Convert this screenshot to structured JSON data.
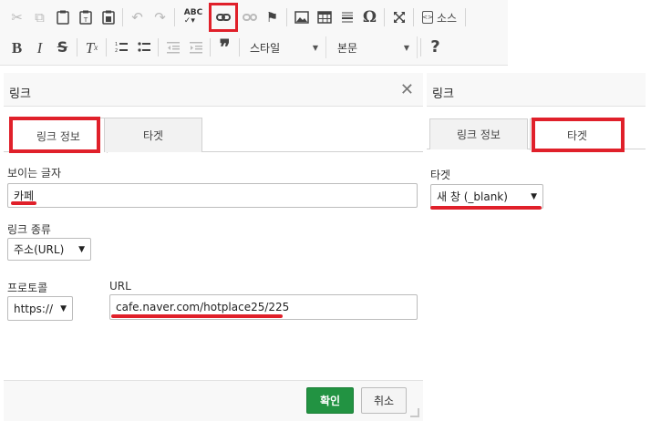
{
  "toolbar": {
    "row1": [
      {
        "name": "cut-icon",
        "glyph": "✂",
        "enabled": false
      },
      {
        "name": "copy-icon",
        "glyph": "⧉",
        "enabled": false
      },
      {
        "name": "paste-icon",
        "glyph": "📋",
        "enabled": true
      },
      {
        "name": "paste-text-icon",
        "glyph": "📄",
        "enabled": true
      },
      {
        "name": "paste-word-icon",
        "glyph": "🗎",
        "enabled": true
      },
      {
        "name": "undo-icon",
        "glyph": "↶",
        "enabled": false
      },
      {
        "name": "redo-icon",
        "glyph": "↷",
        "enabled": false
      },
      {
        "name": "spellcheck-icon",
        "glyph": "ABC",
        "enabled": true
      },
      {
        "name": "link-icon",
        "glyph": "🔗",
        "enabled": true,
        "highlighted": true
      },
      {
        "name": "unlink-icon",
        "glyph": "⛓",
        "enabled": false
      },
      {
        "name": "anchor-flag-icon",
        "glyph": "⚑",
        "enabled": true
      },
      {
        "name": "image-icon",
        "glyph": "🖼",
        "enabled": true
      },
      {
        "name": "table-icon",
        "glyph": "▦",
        "enabled": true
      },
      {
        "name": "horizontal-line-icon",
        "glyph": "≡",
        "enabled": true
      },
      {
        "name": "special-char-icon",
        "glyph": "Ω",
        "enabled": true
      },
      {
        "name": "maximize-icon",
        "glyph": "⤢",
        "enabled": true
      }
    ],
    "source_label": "소스",
    "row2": [
      {
        "name": "bold-icon",
        "glyph": "B"
      },
      {
        "name": "italic-icon",
        "glyph": "I"
      },
      {
        "name": "strike-icon",
        "glyph": "S"
      },
      {
        "name": "remove-format-icon",
        "glyph": "Tx"
      },
      {
        "name": "numbered-list-icon",
        "glyph": "⒈"
      },
      {
        "name": "bulleted-list-icon",
        "glyph": "•"
      },
      {
        "name": "outdent-icon",
        "glyph": "⇤"
      },
      {
        "name": "indent-icon",
        "glyph": "⇥"
      },
      {
        "name": "blockquote-icon",
        "glyph": "❞"
      }
    ],
    "style_combo": "스타일",
    "format_combo": "본문",
    "help_glyph": "?"
  },
  "dialog": {
    "title": "링크",
    "close_glyph": "✕",
    "tabs": [
      {
        "label": "링크 정보"
      },
      {
        "label": "타겟"
      }
    ],
    "display_text_label": "보이는 글자",
    "display_text_value": "카페",
    "link_type_label": "링크 종류",
    "link_type_value": "주소(URL)",
    "protocol_label": "프로토콜",
    "protocol_value": "https://",
    "url_label": "URL",
    "url_value": "cafe.naver.com/hotplace25/225",
    "ok_label": "확인",
    "cancel_label": "취소"
  },
  "side_panel": {
    "title": "링크",
    "tabs": [
      {
        "label": "링크 정보"
      },
      {
        "label": "타겟"
      }
    ],
    "target_label": "타겟",
    "target_value": "새 창 (_blank)"
  },
  "colors": {
    "highlight": "#e0202a",
    "ok_button": "#229342",
    "toolbar_bg": "#f8f8f8"
  }
}
